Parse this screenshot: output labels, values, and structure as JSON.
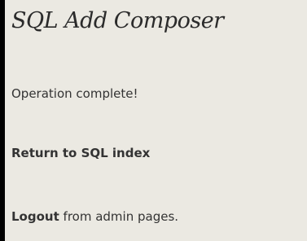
{
  "page": {
    "title": "SQL Add Composer"
  },
  "content": {
    "status_message": "Operation complete!",
    "return_link_label": "Return to SQL index",
    "logout_link_label": "Logout",
    "logout_suffix": " from admin pages."
  },
  "colors": {
    "background": "#ebe9e2",
    "frame": "#000000",
    "text": "#333333",
    "title": "#2b2b2b"
  }
}
